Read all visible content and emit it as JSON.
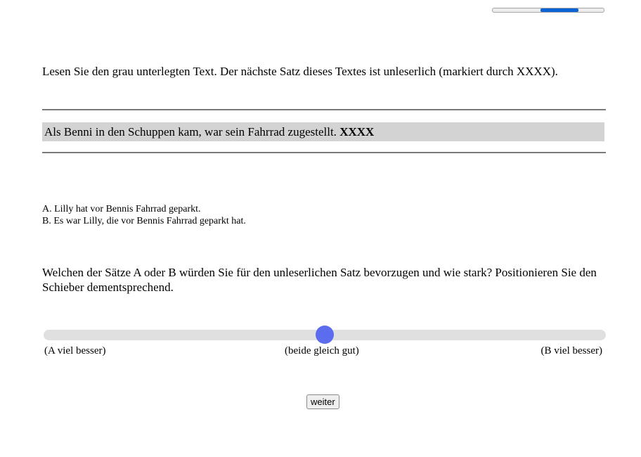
{
  "progress": {
    "start_fraction": 0.43,
    "end_fraction": 0.77,
    "color": "#0a64d8"
  },
  "instruction": "Lesen Sie den grau unterlegten Text. Der nächste Satz dieses Textes ist unleserlich (markiert durch XXXX).",
  "context": {
    "sentence": "Als Benni in den Schuppen kam, war sein Fahrrad zugestellt.",
    "placeholder": "XXXX",
    "background_color": "#d3d3d3"
  },
  "options": {
    "a": "A. Lilly hat vor Bennis Fahrrad geparkt.",
    "b": "B. Es war Lilly, die vor Bennis Fahrrad geparkt hat."
  },
  "question": "Welchen der Sätze A oder B würden Sie für den unleserlichen Satz bevorzugen und wie stark? Positionieren Sie den Schieber dementsprechend.",
  "slider": {
    "value": 0.5,
    "thumb_color": "#5c6cee",
    "label_left": "(A viel besser)",
    "label_middle": "(beide gleich gut)",
    "label_right": "(B viel besser)"
  },
  "next_button_label": "weiter"
}
